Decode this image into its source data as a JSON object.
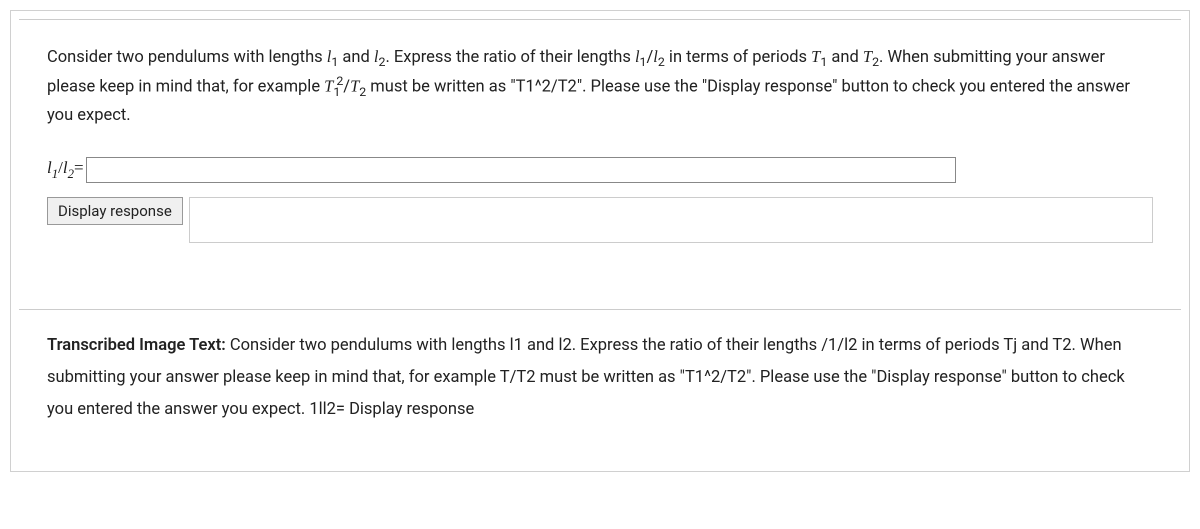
{
  "question": {
    "p1": "Consider two pendulums with lengths ",
    "l1": "l",
    "l1sub": "1",
    "and1": " and ",
    "l2": "l",
    "l2sub": "2",
    "p2": ". Express the ratio of their lengths ",
    "ratio_l1": "l",
    "ratio_l1sub": "1",
    "slash": "/",
    "ratio_l2": "l",
    "ratio_l2sub": "2",
    "p3": " in terms of periods ",
    "T1": "T",
    "T1sub": "1",
    "and2": " and ",
    "T2": "T",
    "T2sub": "2",
    "p4": ". When submitting your answer please keep in mind that, for example ",
    "ex_T1": "T",
    "ex_T1sub": "1",
    "ex_T1sup": "2",
    "ex_slash": "/",
    "ex_T2": "T",
    "ex_T2sub": "2",
    "p5": " must be written as \"T1^2/T2\". Please use the \"Display response\" button to check you entered the answer you expect."
  },
  "input": {
    "label_l1": "l",
    "label_l1sub": "1",
    "label_slash": "/",
    "label_l2": "l",
    "label_l2sub": "2",
    "label_eq": "=",
    "value": ""
  },
  "button": {
    "display_response": "Display response"
  },
  "transcribed": {
    "label": "Transcribed Image Text:",
    "text": "  Consider two pendulums with lengths l1 and l2. Express the ratio of their lengths /1/l2 in terms of periods Tj and T2. When submitting your answer please keep in mind that, for example T/T2 must be written as \"T1^2/T2\". Please use the \"Display response\" button to check you entered the answer you expect. 1ll2= Display response"
  }
}
